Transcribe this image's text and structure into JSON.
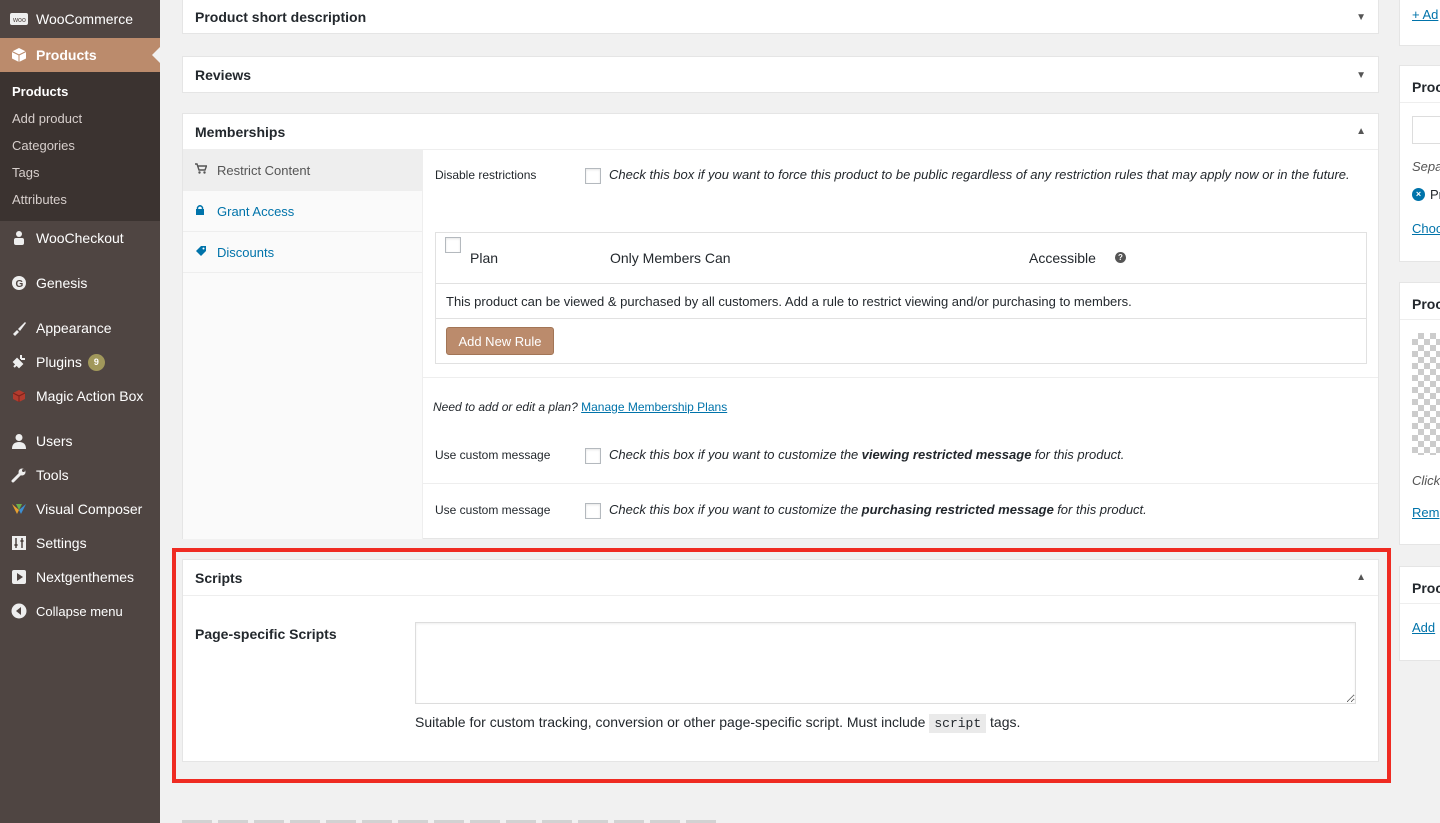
{
  "sidebar": {
    "items": [
      {
        "label": "WooCommerce",
        "icon": "woo-icon"
      },
      {
        "label": "Products",
        "icon": "products-icon"
      },
      {
        "label": "WooCheckout",
        "icon": "woocheckout-icon"
      },
      {
        "label": "Genesis",
        "icon": "genesis-icon"
      },
      {
        "label": "Appearance",
        "icon": "appearance-icon"
      },
      {
        "label": "Plugins",
        "icon": "plugins-icon",
        "badge": "9"
      },
      {
        "label": "Magic Action Box",
        "icon": "magic-box-icon"
      },
      {
        "label": "Users",
        "icon": "users-icon"
      },
      {
        "label": "Tools",
        "icon": "tools-icon"
      },
      {
        "label": "Visual Composer",
        "icon": "visual-composer-icon"
      },
      {
        "label": "Settings",
        "icon": "settings-icon"
      },
      {
        "label": "Nextgenthemes",
        "icon": "nextgenthemes-icon"
      },
      {
        "label": "Collapse menu",
        "icon": "collapse-icon"
      }
    ],
    "submenu": [
      "Products",
      "Add product",
      "Categories",
      "Tags",
      "Attributes"
    ]
  },
  "panels": {
    "short_description": "Product short description",
    "reviews": "Reviews",
    "memberships": "Memberships",
    "scripts": "Scripts"
  },
  "memberships": {
    "tabs": [
      {
        "label": "Restrict Content",
        "icon": "cart-icon"
      },
      {
        "label": "Grant Access",
        "icon": "lock-icon"
      },
      {
        "label": "Discounts",
        "icon": "tag-icon"
      }
    ],
    "disable_label": "Disable restrictions",
    "disable_desc": "Check this box if you want to force this product to be public regardless of any restriction rules that may apply now or in the future.",
    "table": {
      "col_plan": "Plan",
      "col_only": "Only Members Can",
      "col_accessible": "Accessible",
      "message": "This product can be viewed & purchased by all customers. Add a rule to restrict viewing and/or purchasing to members."
    },
    "add_rule_label": "Add New Rule",
    "need_plan": "Need to add or edit a plan?",
    "manage_plans": "Manage Membership Plans",
    "custom_msg_label_1": "Use custom message",
    "custom_msg_desc_1_pre": "Check this box if you want to customize the",
    "custom_msg_desc_1_bold": "viewing restricted message",
    "custom_msg_desc_1_post": "for this product.",
    "custom_msg_label_2": "Use custom message",
    "custom_msg_desc_2_pre": "Check this box if you want to customize the",
    "custom_msg_desc_2_bold": "purchasing restricted message",
    "custom_msg_desc_2_post": "for this product."
  },
  "scripts": {
    "label": "Page-specific Scripts",
    "textarea_value": "",
    "help_pre": "Suitable for custom tracking, conversion or other page-specific script. Must include",
    "help_code": "script",
    "help_post": "tags."
  },
  "right": {
    "add_link": "+ Ad",
    "box2_title": "Proc",
    "box2_sep": "Sepa",
    "box2_item": "Pr",
    "box2_link": "Choo",
    "box3_title": "Proc",
    "box3_click": "Click",
    "box3_link": "Rem",
    "box4_title": "Proc",
    "box4_link": "Add"
  }
}
